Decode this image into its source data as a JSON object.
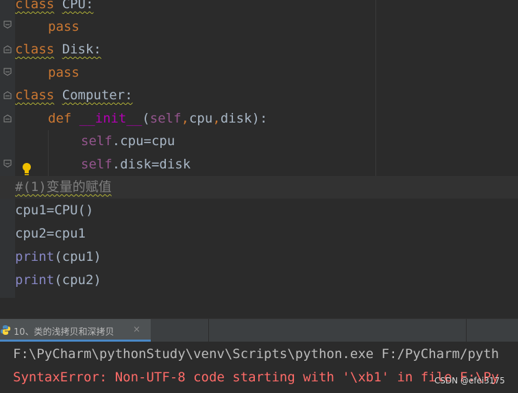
{
  "editor": {
    "lines": [
      [
        "class",
        " ",
        "CPU:"
      ],
      [
        "pass"
      ],
      [
        "class",
        " ",
        "Disk:"
      ],
      [
        "pass"
      ],
      [
        "class",
        " ",
        "Computer:"
      ],
      [
        "def",
        " ",
        "__init__",
        "(",
        "self",
        ",",
        "cpu",
        ",",
        "disk",
        "):"
      ],
      [
        "self",
        ".cpu=cpu"
      ],
      [
        "self",
        ".disk=disk"
      ],
      [
        "#(1)变量的赋值"
      ],
      [
        "cpu1=CPU()"
      ],
      [
        "cpu2=cpu1"
      ],
      [
        "print",
        "(cpu1)"
      ],
      [
        "print",
        "(cpu2)"
      ]
    ]
  },
  "run_panel": {
    "tab_label": "10、类的浅拷贝和深拷贝",
    "close_symbol": "×",
    "console": {
      "line1": "F:\\PyCharm\\pythonStudy\\venv\\Scripts\\python.exe F:/PyCharm/pyth",
      "line2": "SyntaxError: Non-UTF-8 code starting with '\\xb1' in file F:\\Py"
    }
  },
  "watermark": "CSDN @efei3175",
  "colors": {
    "editor_bg": "#2b2b2b",
    "keyword": "#cc7832",
    "self": "#94558d",
    "magic_method": "#b200b2",
    "builtin": "#8888c6",
    "comment": "#808080",
    "default_text": "#a9b7c6",
    "error_text": "#ff6b68",
    "tab_accent": "#4a88c7"
  },
  "icons": [
    "fold-icon",
    "lightbulb-icon",
    "python-icon",
    "close-icon"
  ]
}
